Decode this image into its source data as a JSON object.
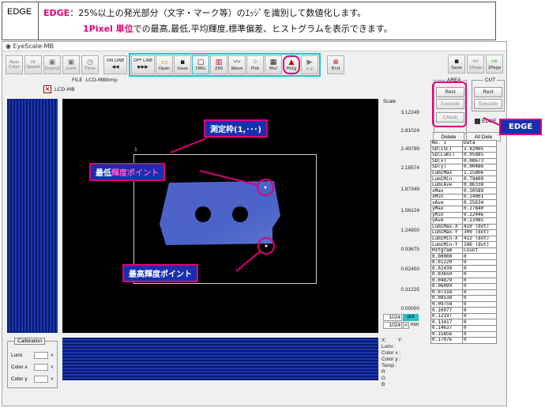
{
  "header": {
    "tag": "EDGE",
    "line1_keyword": "EDGE",
    "line1_text": "：25%以上の発光部分（文字・マーク等）のｴｯｼﾞを識別して数値化します。",
    "line2_keyword": "1Pixel 単位",
    "line2_text": "での最高,最低,平均輝度,標準偏差、ヒストグラムを表示できます。"
  },
  "app": {
    "title": "EyeScale-MB",
    "toolbar": {
      "real_color": "Real Color",
      "hi_speed": "Hi Speed",
      "zoom2": "Zoom2",
      "lumi": "Lumi",
      "time": "Time",
      "online": "ON LINE",
      "offline": "OFF LINE",
      "open": "Open",
      "save": "Save",
      "org": "ORG",
      "c256": "256",
      "wave": "Wave",
      "plot": "Plot",
      "mul": "Mul",
      "hstg": "Hstg",
      "xy": "x,y",
      "end": "End",
      "save2": "Save",
      "page1": "1Page",
      "page2": "2Page"
    },
    "file_label": "FILE",
    "file_name": "LCD-MBbmp",
    "view_tag": "LCD-MB",
    "frame_number": "1",
    "scale": {
      "title": "Scale",
      "values": [
        "3.12249",
        "2.81024",
        "2.49799",
        "2.18574",
        "1.87349",
        "1.56124",
        "1.24900",
        "0.93675",
        "0.62450",
        "0.31225",
        "0.00000"
      ]
    },
    "dot_box": {
      "v1": "1024",
      "u1": "dot",
      "v2": "1024",
      "sym": "<",
      "u2": "mm"
    },
    "coords": [
      "X:",
      "Y:",
      "Lumi :",
      "Color x :",
      "Color y :",
      "Temp :",
      "R",
      "G",
      "B"
    ],
    "calibration": {
      "title": "Calibration",
      "lumi": "Lumi",
      "color_x": "Color x",
      "color_y": "Color y"
    },
    "area": {
      "label": "AREA",
      "rect": "Rect",
      "execute": "Execute",
      "check": "Check"
    },
    "cut": {
      "label": "CUT",
      "rect": "Rect",
      "execute": "Execute"
    },
    "edge_check_label": "EDGE",
    "delete_label": "Delete",
    "all_delete_label": "All Dele",
    "table": [
      [
        "No. 1",
        "Data"
      ],
      [
        "SD(ISC)",
        "5.82005"
      ],
      [
        "SD(Lumi)",
        "0.05885"
      ],
      [
        "SD(x)",
        "0.00673"
      ],
      [
        "SD(y)",
        "0.00486"
      ],
      [
        "LumiMax",
        "1.25806"
      ],
      [
        "LumiMin",
        "0.79409"
      ],
      [
        "LumiAve",
        "0.86338"
      ],
      [
        "xMax",
        "0.30589"
      ],
      [
        "xMin",
        "0.24001"
      ],
      [
        "xAve",
        "0.25634"
      ],
      [
        "yMax",
        "0.27840"
      ],
      [
        "yMin",
        "0.22446"
      ],
      [
        "yAve",
        "0.23985"
      ],
      [
        "LumiMax-X",
        "410 (dot)"
      ],
      [
        "LumiMax-Y",
        "309 (dot)"
      ],
      [
        "LumiMin-X",
        "412 (dot)"
      ],
      [
        "LumiMin-Y",
        "186 (dot)"
      ],
      [
        "Hstgram",
        "Count"
      ],
      [
        "0.00000",
        "0"
      ],
      [
        "0.01220",
        "0"
      ],
      [
        "0.02439",
        "0"
      ],
      [
        "0.03659",
        "0"
      ],
      [
        "0.04879",
        "0"
      ],
      [
        "0.06099",
        "0"
      ],
      [
        "0.07318",
        "0"
      ],
      [
        "0.08538",
        "0"
      ],
      [
        "0.09758",
        "0"
      ],
      [
        "0.10977",
        "0"
      ],
      [
        "0.12197",
        "0"
      ],
      [
        "0.13417",
        "0"
      ],
      [
        "0.14637",
        "0"
      ],
      [
        "0.15856",
        "0"
      ],
      [
        "0.17076",
        "0"
      ]
    ]
  },
  "callouts": {
    "frame": "測定枠(1,･･･)",
    "min_a": "最低",
    "min_b": "輝度ポイント",
    "max": "最高輝度ポイント",
    "edge": "EDGE"
  },
  "colors": {
    "accent_magenta": "#e0007a",
    "accent_cyan": "#23c2c8",
    "callout_blue": "#1a2fb0"
  }
}
